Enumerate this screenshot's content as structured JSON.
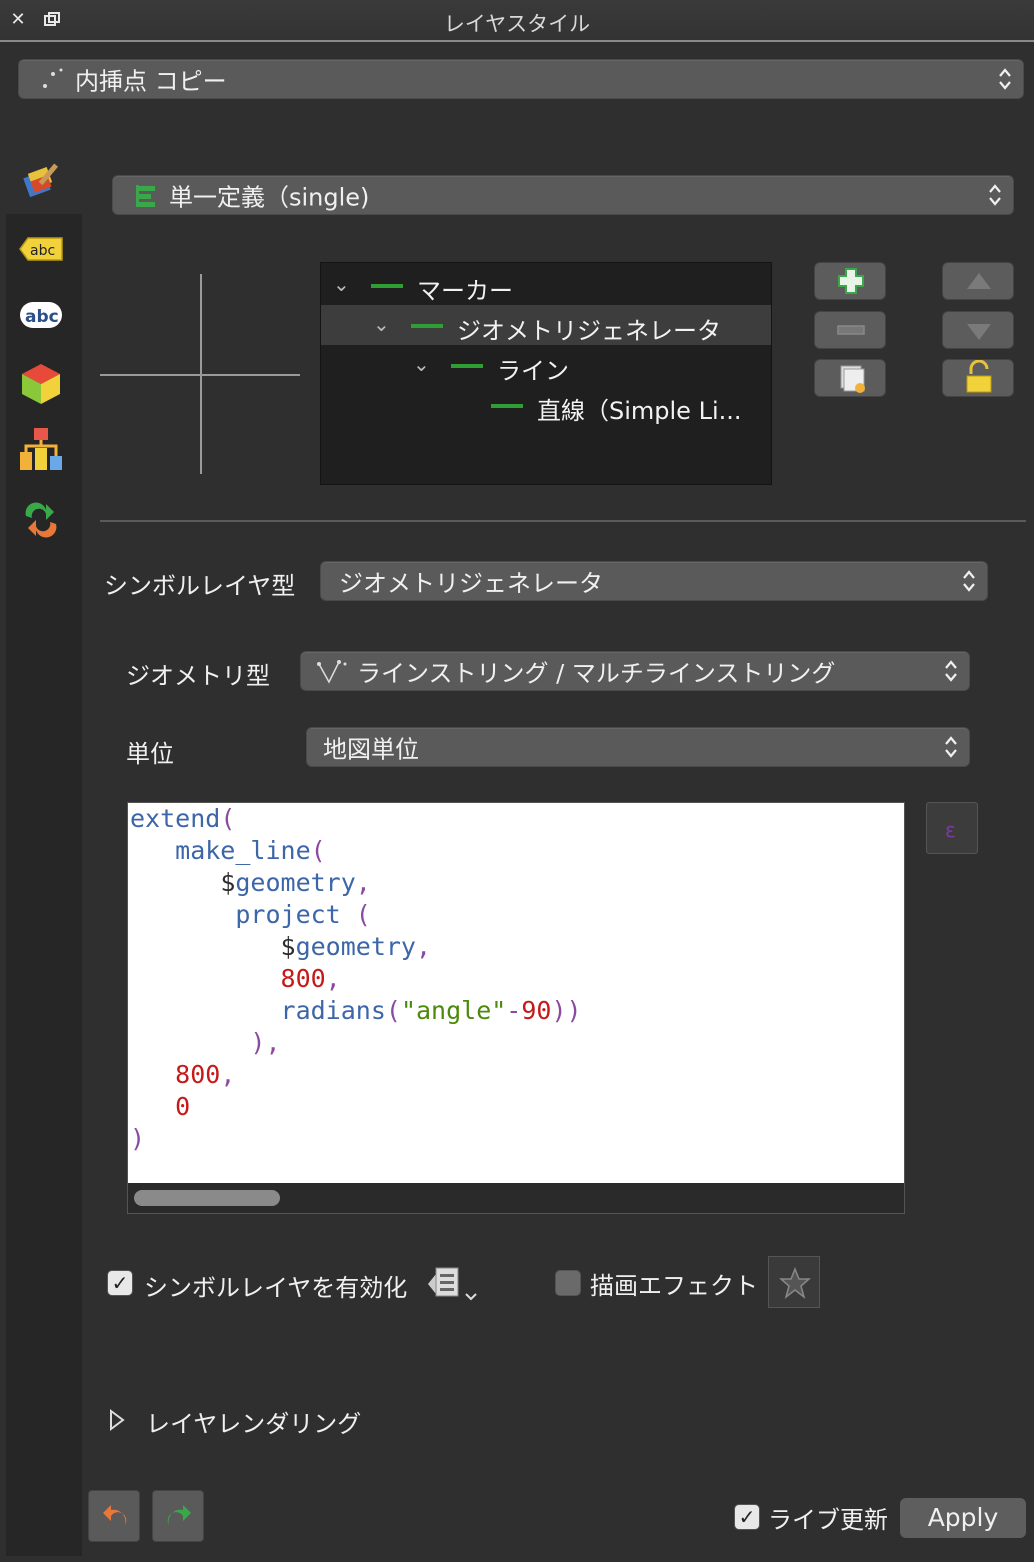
{
  "window": {
    "title": "レイヤスタイル",
    "close_icon": "close-icon",
    "restore_icon": "restore-icon"
  },
  "layer_combo": {
    "value": "内挿点 コピー",
    "icon": "point-layer-icon"
  },
  "renderer_combo": {
    "value": "単一定義（single)",
    "icon": "single-symbol-icon"
  },
  "sidebar": {
    "items": [
      {
        "icon": "symbology-brush-icon",
        "label": "symbology"
      },
      {
        "icon": "labels-abc-icon",
        "label": "labels"
      },
      {
        "icon": "masks-abc-icon",
        "label": "masks"
      },
      {
        "icon": "3d-cube-icon",
        "label": "3d"
      },
      {
        "icon": "diagrams-icon",
        "label": "diagrams"
      },
      {
        "icon": "history-icon",
        "label": "history"
      }
    ]
  },
  "symbol_tree": {
    "rows": [
      {
        "label": "マーカー",
        "level": 0,
        "expanded": true,
        "selected": false
      },
      {
        "label": "ジオメトリジェネレータ",
        "level": 1,
        "expanded": true,
        "selected": true
      },
      {
        "label": "ライン",
        "level": 2,
        "expanded": true,
        "selected": false
      },
      {
        "label": "直線（Simple Li...",
        "level": 3,
        "expanded": false,
        "selected": false
      }
    ]
  },
  "tree_buttons": {
    "add": "add-layer-icon",
    "remove": "remove-layer-icon",
    "duplicate": "duplicate-layer-icon",
    "up": "move-up-icon",
    "down": "move-down-icon",
    "lock": "lock-color-icon"
  },
  "symbol_layer_type": {
    "label": "シンボルレイヤ型",
    "value": "ジオメトリジェネレータ"
  },
  "geometry_type": {
    "label": "ジオメトリ型",
    "value": "ラインストリング / マルチラインストリング",
    "icon": "linestring-icon"
  },
  "units": {
    "label": "単位",
    "value": "地図単位"
  },
  "expression": {
    "lines": [
      [
        [
          "fn",
          "extend"
        ],
        [
          "pn",
          "("
        ]
      ],
      [
        [
          "sp",
          "   "
        ],
        [
          "fn",
          "make_line"
        ],
        [
          "pn",
          "("
        ]
      ],
      [
        [
          "sp",
          "      "
        ],
        [
          "var",
          "$"
        ],
        [
          "fn",
          "geometry"
        ],
        [
          "pn",
          ","
        ]
      ],
      [
        [
          "sp",
          "       "
        ],
        [
          "fn",
          "project"
        ],
        [
          "sp",
          " "
        ],
        [
          "pn",
          "("
        ]
      ],
      [
        [
          "sp",
          "          "
        ],
        [
          "var",
          "$"
        ],
        [
          "fn",
          "geometry"
        ],
        [
          "pn",
          ","
        ]
      ],
      [
        [
          "sp",
          "          "
        ],
        [
          "num",
          "800"
        ],
        [
          "pn",
          ","
        ]
      ],
      [
        [
          "sp",
          "          "
        ],
        [
          "fn",
          "radians"
        ],
        [
          "pn",
          "("
        ],
        [
          "str",
          "\"angle\""
        ],
        [
          "pn",
          "-"
        ],
        [
          "num",
          "90"
        ],
        [
          "pn",
          "))"
        ]
      ],
      [
        [
          "sp",
          "        "
        ],
        [
          "pn",
          "),"
        ]
      ],
      [
        [
          "sp",
          "   "
        ],
        [
          "num",
          "800"
        ],
        [
          "pn",
          ","
        ]
      ],
      [
        [
          "sp",
          "   "
        ],
        [
          "num",
          "0"
        ]
      ],
      [
        [
          "pn",
          ")"
        ]
      ]
    ]
  },
  "expression_button_icon": "expression-icon",
  "enable_layer": {
    "label": "シンボルレイヤを有効化",
    "checked": true,
    "icon": "data-defined-icon"
  },
  "draw_effects": {
    "label": "描画エフェクト",
    "checked": false,
    "icon": "star-effects-icon"
  },
  "layer_rendering": {
    "label": "レイヤレンダリング"
  },
  "footer": {
    "undo_icon": "undo-icon",
    "redo_icon": "redo-icon",
    "live_update_label": "ライブ更新",
    "live_update_checked": true,
    "apply_label": "Apply"
  }
}
